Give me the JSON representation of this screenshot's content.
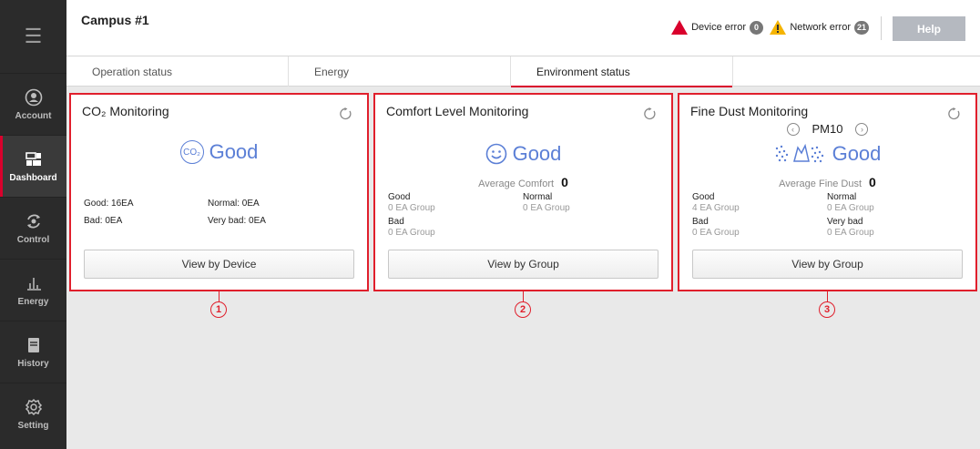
{
  "sidebar": {
    "items": [
      {
        "label": "Account",
        "icon": "account-icon"
      },
      {
        "label": "Dashboard",
        "icon": "dashboard-icon"
      },
      {
        "label": "Control",
        "icon": "control-icon"
      },
      {
        "label": "Energy",
        "icon": "energy-icon"
      },
      {
        "label": "History",
        "icon": "history-icon"
      },
      {
        "label": "Setting",
        "icon": "setting-icon"
      }
    ]
  },
  "header": {
    "title": "Campus #1",
    "device_error_label": "Device error",
    "device_error_count": "0",
    "network_error_label": "Network error",
    "network_error_count": "21",
    "help_label": "Help"
  },
  "tabs": [
    {
      "label": "Operation status"
    },
    {
      "label": "Energy"
    },
    {
      "label": "Environment status"
    }
  ],
  "co2": {
    "title": "CO₂ Monitoring",
    "icon_text": "CO₂",
    "status": "Good",
    "good": "Good: 16EA",
    "normal": "Normal: 0EA",
    "bad": "Bad: 0EA",
    "very_bad": "Very bad: 0EA",
    "button": "View by Device"
  },
  "comfort": {
    "title": "Comfort Level Monitoring",
    "status": "Good",
    "avg_label": "Average Comfort",
    "avg_value": "0",
    "good": "Good",
    "good_sub": "0 EA Group",
    "normal": "Normal",
    "normal_sub": "0 EA Group",
    "bad": "Bad",
    "bad_sub": "0 EA Group",
    "button": "View by Group"
  },
  "dust": {
    "title": "Fine Dust Monitoring",
    "pm": "PM10",
    "status": "Good",
    "avg_label": "Average Fine Dust",
    "avg_value": "0",
    "good": "Good",
    "good_sub": "4 EA Group",
    "normal": "Normal",
    "normal_sub": "0 EA Group",
    "bad": "Bad",
    "bad_sub": "0 EA Group",
    "very_bad": "Very bad",
    "very_bad_sub": "0 EA Group",
    "button": "View by Group"
  },
  "callouts": [
    "1",
    "2",
    "3"
  ],
  "colors": {
    "accent": "#d9002c",
    "status_blue": "#5b7fd6",
    "sidebar": "#2b2b2b"
  }
}
